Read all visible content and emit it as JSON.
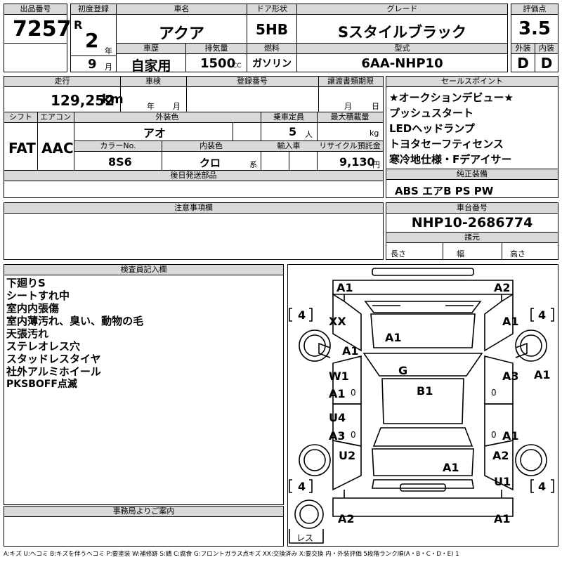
{
  "header": {
    "lot_label": "出品番号",
    "lot_value": "7257",
    "first_reg_label": "初度登録",
    "era": "R",
    "reg_year": "2",
    "year_unit": "年",
    "reg_month": "9",
    "month_unit": "月",
    "car_name_label": "車名",
    "car_name": "アクア",
    "door_label": "ドア形状",
    "door": "5HB",
    "grade_label": "グレード",
    "grade": "Sスタイルブラック",
    "score_label": "評価点",
    "score": "3.5",
    "history_label": "車歴",
    "history": "自家用",
    "displacement_label": "排気量",
    "displacement": "1500",
    "displacement_unit": "CC",
    "fuel_label": "燃料",
    "fuel": "ガソリン",
    "model_label": "型式",
    "model": "6AA-NHP10",
    "exterior_label": "外装",
    "exterior": "D",
    "interior_label": "内装",
    "interior": "D"
  },
  "row2": {
    "mileage_label": "走行",
    "mileage": "129,252",
    "mileage_unit": "km",
    "inspection_label": "車検",
    "insp_year_unit": "年",
    "insp_month_unit": "月",
    "regno_label": "登録番号",
    "transfer_label": "譲渡書類期限",
    "transfer_month_unit": "月",
    "transfer_day_unit": "日",
    "shift_label": "シフト",
    "shift": "FAT",
    "ac_label": "エアコン",
    "ac": "AAC",
    "color_label": "外装色",
    "color": "アオ",
    "capacity_label": "乗車定員",
    "capacity": "5",
    "capacity_unit": "人",
    "load_label": "最大積載量",
    "load_unit": "kg",
    "colorno_label": "カラーNo.",
    "colorno": "8S6",
    "interior_color_label": "内装色",
    "interior_color": "クロ",
    "interior_color_unit": "系",
    "import_label": "輸入車",
    "recycle_label": "リサイクル預託金",
    "recycle": "9,130",
    "recycle_unit": "円",
    "later_label": "後日発送部品"
  },
  "sales": {
    "label": "セールスポイント",
    "items": [
      "★オークションデビュー★",
      "プッシュスタート",
      "LEDヘッドランプ",
      "トヨタセーフティセンス",
      "寒冷地仕様・Fデアイサー"
    ]
  },
  "equipment": {
    "label": "純正装備",
    "value": "ABS エアB PS PW"
  },
  "caution": {
    "label": "注意事項欄"
  },
  "chassis": {
    "label": "車台番号",
    "value": "NHP10-2686774",
    "spec_label": "諸元",
    "length_label": "長さ",
    "width_label": "幅",
    "height_label": "高さ"
  },
  "inspector": {
    "label": "検査員記入欄",
    "notes": [
      "下廻りS",
      "シートすれ中",
      "室内内張傷",
      "室内薄汚れ、臭い、動物の毛",
      "天張汚れ",
      "ステレオレス穴",
      "スタッドレスタイヤ",
      "社外アルミホイール",
      "PKSBOFF点滅"
    ]
  },
  "office": {
    "label": "事務局よりご案内"
  },
  "diagram": {
    "labels": {
      "front_left": "A1",
      "front_right": "A2",
      "hood": "A1",
      "xx": "XX",
      "fender_right": "A1",
      "fender_left_low": "A1",
      "front_door_left_top": "W1",
      "front_door_left_bot": "A1",
      "roof": "G",
      "roof_b": "B1",
      "front_door_right": "A3",
      "pillar_right": "A1",
      "rear_door_left_top": "U4",
      "rear_door_left_bot": "A3",
      "rear_door_right": "A1",
      "rear_fender_left": "U2",
      "trunk": "A1",
      "rear_fender_right": "A2",
      "quarter_right": "U1",
      "rear_left": "A2",
      "rear_right": "A1"
    },
    "tire_fl": "4",
    "tire_fr": "4",
    "tire_rl": "4",
    "tire_rr": "4",
    "spare": "レス",
    "zero": "0"
  },
  "legend": "A:キズ U:ヘコミ B:キズを伴うヘコミ P:要塗装 W:補修跡 S:錆 C:腐食 G:フロントガラス点キズ XX:交換済み X:要交換 内・外装評価 5段階ランク順(A・B・C・D・E) 1"
}
